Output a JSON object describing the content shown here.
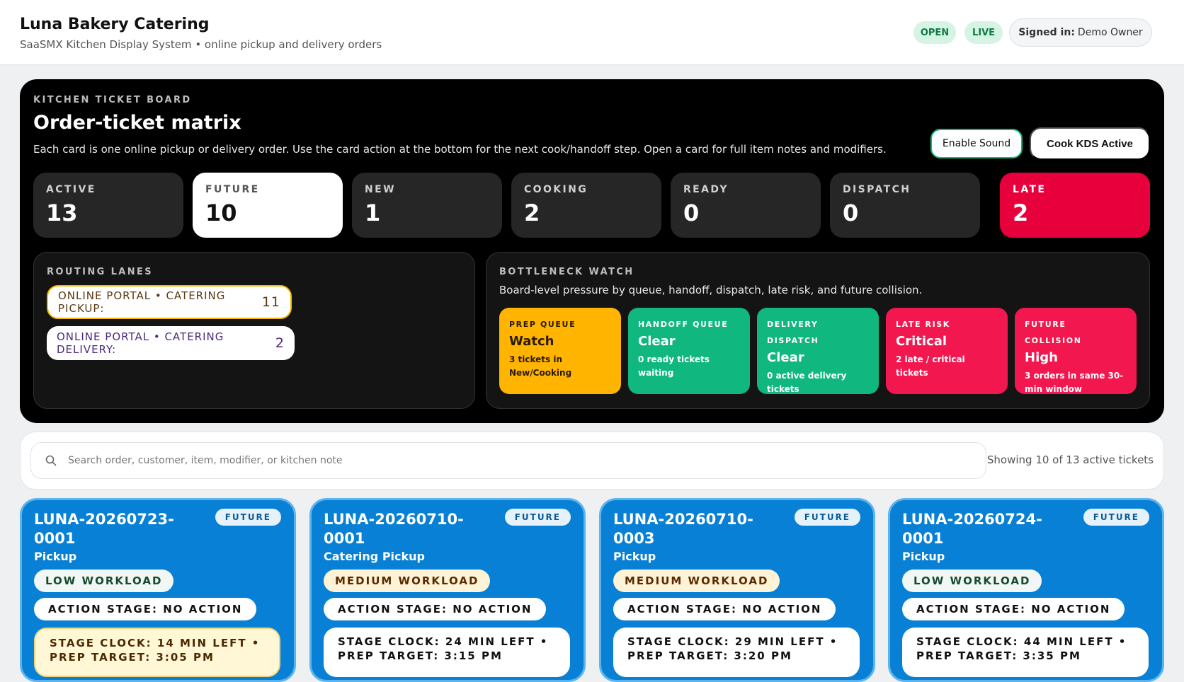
{
  "header": {
    "title": "Luna Bakery Catering",
    "subtitle": "SaaSMX Kitchen Display System • online pickup and delivery orders",
    "status_open": "OPEN",
    "status_live": "LIVE",
    "signed_label": "Signed in:",
    "signed_user": "Demo Owner"
  },
  "board": {
    "eyebrow": "Kitchen Ticket Board",
    "title": "Order-ticket matrix",
    "description": "Each card is one online pickup or delivery order. Use the card action at the bottom for the next cook/handoff step. Open a card for full item notes and modifiers.",
    "enable_sound": "Enable Sound",
    "cook_kds": "Cook KDS Active",
    "stats": [
      {
        "label": "ACTIVE",
        "value": "13"
      },
      {
        "label": "FUTURE",
        "value": "10"
      },
      {
        "label": "NEW",
        "value": "1"
      },
      {
        "label": "COOKING",
        "value": "2"
      },
      {
        "label": "READY",
        "value": "0"
      },
      {
        "label": "DISPATCH",
        "value": "0"
      },
      {
        "label": "LATE",
        "value": "2"
      }
    ]
  },
  "routing": {
    "eyebrow": "Routing Lanes",
    "lanes": [
      {
        "label": "ONLINE PORTAL • CATERING PICKUP:",
        "count": "11"
      },
      {
        "label": "ONLINE PORTAL • CATERING DELIVERY:",
        "count": "2"
      }
    ]
  },
  "bottleneck": {
    "eyebrow": "Bottleneck Watch",
    "description": "Board-level pressure by queue, handoff, dispatch, late risk, and future collision.",
    "items": [
      {
        "label": "Prep Queue",
        "status": "Watch",
        "detail": "3 tickets in New/Cooking",
        "color": "#ffb400"
      },
      {
        "label": "Handoff Queue",
        "status": "Clear",
        "detail": "0 ready tickets waiting",
        "color": "#10b77f"
      },
      {
        "label": "Delivery Dispatch",
        "status": "Clear",
        "detail": "0 active delivery tickets",
        "color": "#10b77f"
      },
      {
        "label": "Late Risk",
        "status": "Critical",
        "detail": "2 late / critical tickets",
        "color": "#f3174f"
      },
      {
        "label": "Future Collision",
        "status": "High",
        "detail": "3 orders in same 30-min window",
        "color": "#f3174f"
      }
    ]
  },
  "search": {
    "placeholder": "Search order, customer, item, modifier, or kitchen note",
    "showing": "Showing 10 of 13 active tickets"
  },
  "tickets": [
    {
      "order_line1": "LUNA-20260723-",
      "order_line2": "0001",
      "type": "Pickup",
      "badge": "FUTURE",
      "workload": "LOW WORKLOAD",
      "stage": "ACTION STAGE: NO ACTION",
      "clock_line1": "STAGE CLOCK: 14 MIN LEFT •",
      "clock_line2": "PREP TARGET: 3:05 PM"
    },
    {
      "order_line1": "LUNA-20260710-",
      "order_line2": "0001",
      "type": "Catering Pickup",
      "badge": "FUTURE",
      "workload": "MEDIUM WORKLOAD",
      "stage": "ACTION STAGE: NO ACTION",
      "clock_line1": "STAGE CLOCK: 24 MIN LEFT •",
      "clock_line2": "PREP TARGET: 3:15 PM"
    },
    {
      "order_line1": "LUNA-20260710-",
      "order_line2": "0003",
      "type": "Pickup",
      "badge": "FUTURE",
      "workload": "MEDIUM WORKLOAD",
      "stage": "ACTION STAGE: NO ACTION",
      "clock_line1": "STAGE CLOCK: 29 MIN LEFT •",
      "clock_line2": "PREP TARGET: 3:20 PM"
    },
    {
      "order_line1": "LUNA-20260724-",
      "order_line2": "0001",
      "type": "Pickup",
      "badge": "FUTURE",
      "workload": "LOW WORKLOAD",
      "stage": "ACTION STAGE: NO ACTION",
      "clock_line1": "STAGE CLOCK: 44 MIN LEFT •",
      "clock_line2": "PREP TARGET: 3:35 PM"
    }
  ]
}
